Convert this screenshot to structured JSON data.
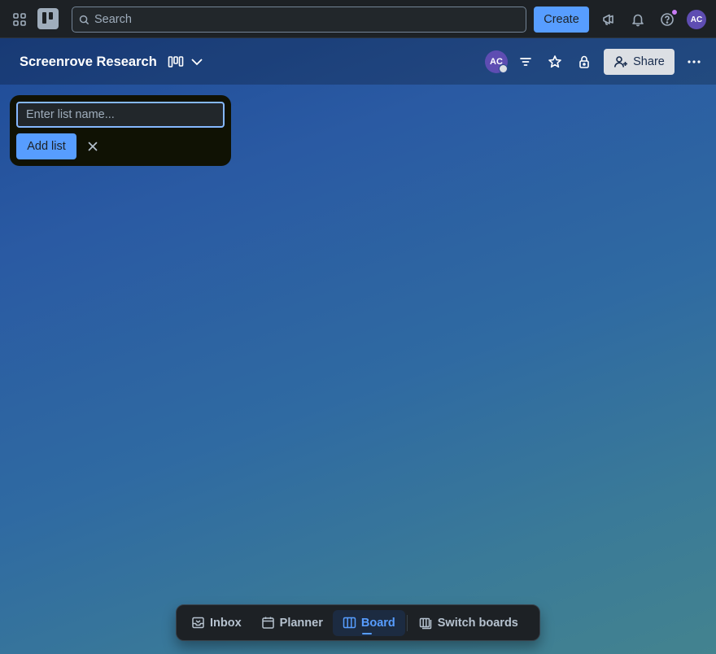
{
  "topbar": {
    "search_placeholder": "Search",
    "create_label": "Create",
    "user_initials": "AC"
  },
  "board": {
    "title": "Screenrove Research",
    "member_initials": "AC",
    "share_label": "Share"
  },
  "composer": {
    "list_name_placeholder": "Enter list name...",
    "add_list_label": "Add list"
  },
  "bottom_nav": {
    "items": [
      {
        "label": "Inbox",
        "icon": "inbox-icon"
      },
      {
        "label": "Planner",
        "icon": "calendar-icon"
      },
      {
        "label": "Board",
        "icon": "board-icon",
        "active": true
      },
      {
        "label": "Switch boards",
        "icon": "switch-boards-icon"
      }
    ]
  },
  "colors": {
    "accent": "#579dff",
    "topbar_bg": "#1d2125",
    "avatar_bg": "#5e4db2",
    "notification_dot": "#c97cf4"
  }
}
